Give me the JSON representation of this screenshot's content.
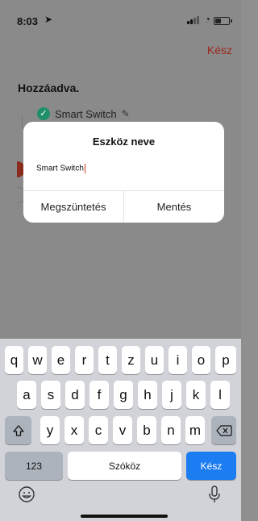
{
  "status": {
    "time": "8:03"
  },
  "header": {
    "done_label": "Kész"
  },
  "page": {
    "section_title": "Hozzáadva.",
    "device_name": "Smart Switch"
  },
  "dialog": {
    "title": "Eszköz neve",
    "input_value": "Smart Switch",
    "cancel_label": "Megszüntetés",
    "save_label": "Mentés"
  },
  "keyboard": {
    "row1": [
      "q",
      "w",
      "e",
      "r",
      "t",
      "z",
      "u",
      "i",
      "o",
      "p"
    ],
    "row2": [
      "a",
      "s",
      "d",
      "f",
      "g",
      "h",
      "j",
      "k",
      "l"
    ],
    "row3": [
      "y",
      "x",
      "c",
      "v",
      "b",
      "n",
      "m"
    ],
    "numbers_label": "123",
    "space_label": "Szóköz",
    "return_label": "Kész",
    "shift_icon": "shift-icon",
    "backspace_icon": "backspace-icon",
    "emoji_icon": "emoji-icon",
    "mic_icon": "microphone-icon"
  },
  "colors": {
    "accent_red": "#9c2a1c",
    "check_green": "#1f8f6a",
    "key_blue": "#1c7cf1"
  }
}
